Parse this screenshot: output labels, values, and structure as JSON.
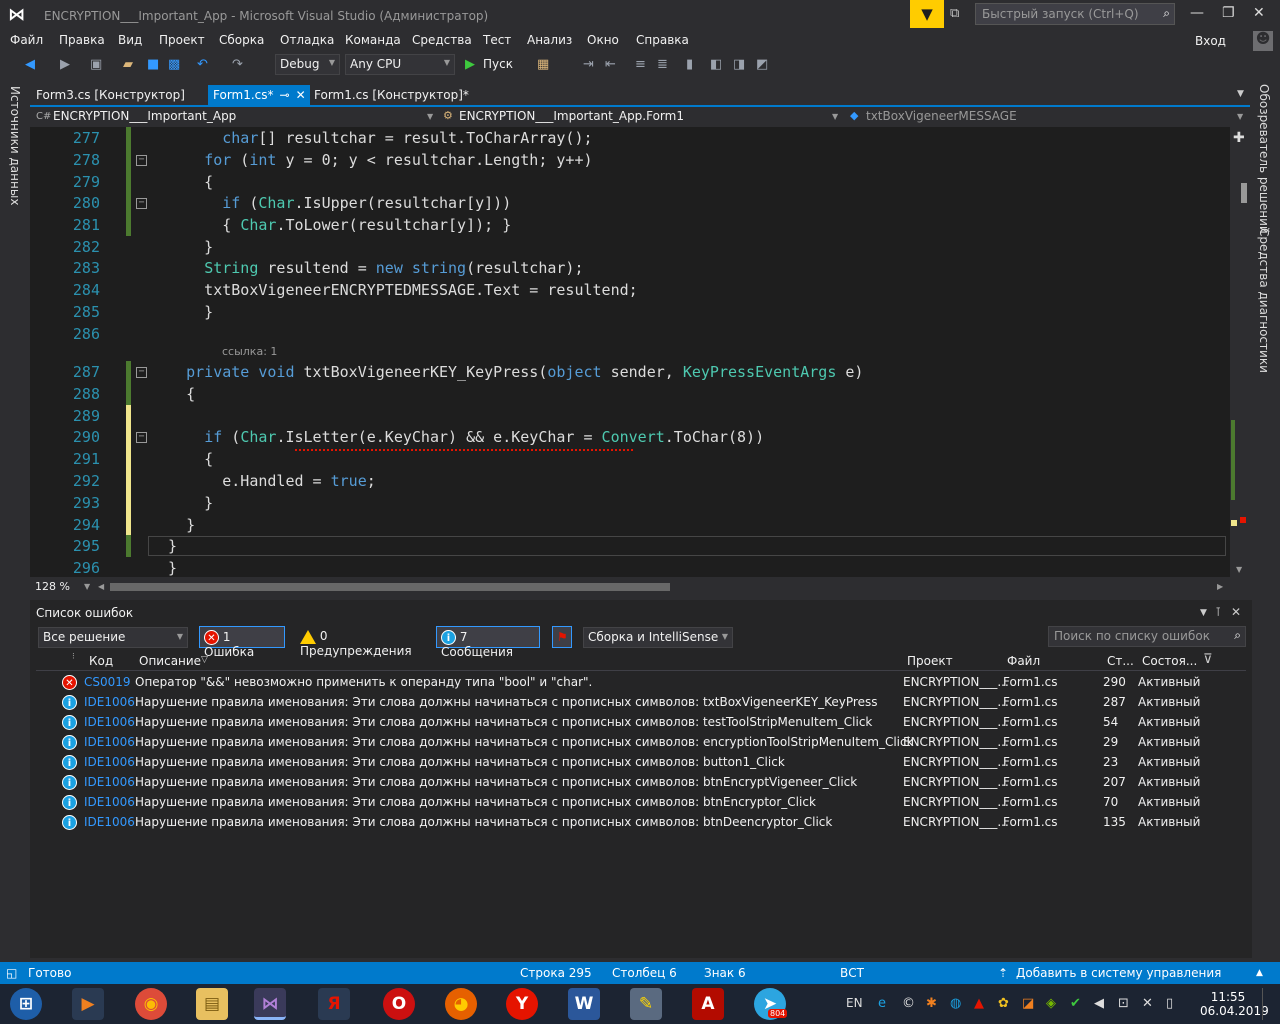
{
  "window": {
    "title": "ENCRYPTION___Important_App - Microsoft Visual Studio (Администратор)",
    "quick_launch_placeholder": "Быстрый запуск (Ctrl+Q)",
    "login": "Вход"
  },
  "menu": [
    "Файл",
    "Правка",
    "Вид",
    "Проект",
    "Сборка",
    "Отладка",
    "Команда",
    "Средства",
    "Тест",
    "Анализ",
    "Окно",
    "Справка"
  ],
  "toolbar": {
    "config": "Debug",
    "platform": "Any CPU",
    "run_label": "Пуск"
  },
  "side_panels": {
    "left": "Источники данных",
    "right_top": "Обозреватель решений",
    "right_bottom": "Средства диагностики"
  },
  "tabs": [
    "Form3.cs [Конструктор]",
    "Form1.cs*",
    "Form1.cs [Конструктор]*"
  ],
  "navbar": {
    "project": "ENCRYPTION___Important_App",
    "class": "ENCRYPTION___Important_App.Form1",
    "member": "txtBoxVigeneerMESSAGE"
  },
  "editor": {
    "zoom": "128 %",
    "ref_label": "ссылка: 1",
    "lines": [
      {
        "n": "277",
        "text": "        char[] resultchar = result.ToCharArray();"
      },
      {
        "n": "278",
        "text": "      for (int y = 0; y < resultchar.Length; y++)"
      },
      {
        "n": "279",
        "text": "      {"
      },
      {
        "n": "280",
        "text": "        if (Char.IsUpper(resultchar[y]))"
      },
      {
        "n": "281",
        "text": "        { Char.ToLower(resultchar[y]); }"
      },
      {
        "n": "282",
        "text": "      }"
      },
      {
        "n": "283",
        "text": "      String resultend = new string(resultchar);"
      },
      {
        "n": "284",
        "text": "      txtBoxVigeneerENCRYPTEDMESSAGE.Text = resultend;"
      },
      {
        "n": "285",
        "text": "      }"
      },
      {
        "n": "286",
        "text": ""
      },
      {
        "n": "287",
        "text": "    private void txtBoxVigeneerKEY_KeyPress(object sender, KeyPressEventArgs e)"
      },
      {
        "n": "288",
        "text": "    {"
      },
      {
        "n": "289",
        "text": ""
      },
      {
        "n": "290",
        "text": "      if (Char.IsLetter(e.KeyChar) && e.KeyChar = Convert.ToChar(8))"
      },
      {
        "n": "291",
        "text": "      {"
      },
      {
        "n": "292",
        "text": "        e.Handled = true;"
      },
      {
        "n": "293",
        "text": "      }"
      },
      {
        "n": "294",
        "text": "    }"
      },
      {
        "n": "295",
        "text": "  }"
      },
      {
        "n": "296",
        "text": "  }"
      }
    ]
  },
  "errors": {
    "panel_title": "Список ошибок",
    "scope": "Все решение",
    "errors_btn": "1 Ошибка",
    "warnings_btn": "0 Предупреждения",
    "messages_btn": "7 Сообщения",
    "source": "Сборка и IntelliSense",
    "search_placeholder": "Поиск по списку ошибок",
    "headers": {
      "code": "Код",
      "desc": "Описание",
      "project": "Проект",
      "file": "Файл",
      "line": "Ст...",
      "state": "Состоя..."
    },
    "rows": [
      {
        "type": "error",
        "code": "CS0019",
        "desc": "Оператор \"&&\" невозможно применить к операнду типа \"bool\" и \"char\".",
        "project": "ENCRYPTION___...",
        "file": "Form1.cs",
        "line": "290",
        "state": "Активный"
      },
      {
        "type": "info",
        "code": "IDE1006",
        "desc": "Нарушение правила именования: Эти слова должны начинаться с прописных символов: txtBoxVigeneerKEY_KeyPress",
        "project": "ENCRYPTION___...",
        "file": "Form1.cs",
        "line": "287",
        "state": "Активный"
      },
      {
        "type": "info",
        "code": "IDE1006",
        "desc": "Нарушение правила именования: Эти слова должны начинаться с прописных символов: testToolStripMenuItem_Click",
        "project": "ENCRYPTION___...",
        "file": "Form1.cs",
        "line": "54",
        "state": "Активный"
      },
      {
        "type": "info",
        "code": "IDE1006",
        "desc": "Нарушение правила именования: Эти слова должны начинаться с прописных символов: encryptionToolStripMenuItem_Click",
        "project": "ENCRYPTION___...",
        "file": "Form1.cs",
        "line": "29",
        "state": "Активный"
      },
      {
        "type": "info",
        "code": "IDE1006",
        "desc": "Нарушение правила именования: Эти слова должны начинаться с прописных символов: button1_Click",
        "project": "ENCRYPTION___...",
        "file": "Form1.cs",
        "line": "23",
        "state": "Активный"
      },
      {
        "type": "info",
        "code": "IDE1006",
        "desc": "Нарушение правила именования: Эти слова должны начинаться с прописных символов: btnEncryptVigeneer_Click",
        "project": "ENCRYPTION___...",
        "file": "Form1.cs",
        "line": "207",
        "state": "Активный"
      },
      {
        "type": "info",
        "code": "IDE1006",
        "desc": "Нарушение правила именования: Эти слова должны начинаться с прописных символов: btnEncryptor_Click",
        "project": "ENCRYPTION___...",
        "file": "Form1.cs",
        "line": "70",
        "state": "Активный"
      },
      {
        "type": "info",
        "code": "IDE1006",
        "desc": "Нарушение правила именования: Эти слова должны начинаться с прописных символов: btnDeencryptor_Click",
        "project": "ENCRYPTION___...",
        "file": "Form1.cs",
        "line": "135",
        "state": "Активный"
      }
    ]
  },
  "status": {
    "ready": "Готово",
    "line": "Строка 295",
    "col": "Столбец 6",
    "char": "Знак 6",
    "mode": "ВСТ",
    "vcs": "Добавить в систему управления версиями"
  },
  "taskbar": {
    "lang": "EN",
    "time": "11:55",
    "date": "06.04.2019",
    "telegram_badge": "804",
    "yandex_glyph": "Я"
  },
  "colors": {
    "accent": "#007acc",
    "keyword": "#569cd6",
    "type": "#4ec9b0",
    "linenum": "#2b91af",
    "error": "#e51400",
    "info": "#1ba1e2"
  }
}
